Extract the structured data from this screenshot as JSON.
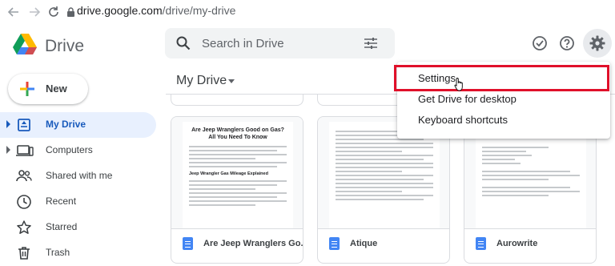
{
  "browser": {
    "url_host": "drive.google.com",
    "url_path": "/drive/my-drive"
  },
  "app": {
    "name": "Drive",
    "search_placeholder": "Search in Drive"
  },
  "sidebar": {
    "new_label": "New",
    "items": [
      {
        "label": "My Drive",
        "icon": "my-drive-icon",
        "active": true
      },
      {
        "label": "Computers",
        "icon": "computer-icon",
        "active": false
      },
      {
        "label": "Shared with me",
        "icon": "people-icon",
        "active": false
      },
      {
        "label": "Recent",
        "icon": "clock-icon",
        "active": false
      },
      {
        "label": "Starred",
        "icon": "star-icon",
        "active": false
      },
      {
        "label": "Trash",
        "icon": "trash-icon",
        "active": false
      }
    ]
  },
  "main": {
    "title": "My Drive",
    "files": [
      {
        "name": "Are Jeep Wranglers Go...",
        "preview_heading": "Are Jeep Wranglers Good on Gas? All You Need To Know",
        "preview_subheading": "Jeep Wrangler Gas Mileage Explained"
      },
      {
        "name": "Atique"
      },
      {
        "name": "Aurowrite"
      }
    ]
  },
  "settings_menu": {
    "items": [
      "Settings",
      "Get Drive for desktop",
      "Keyboard shortcuts"
    ]
  },
  "colors": {
    "accent": "#1a73e8",
    "active_bg": "#e8f0fe",
    "highlight": "#e0102a",
    "doc_icon": "#4285f4"
  }
}
